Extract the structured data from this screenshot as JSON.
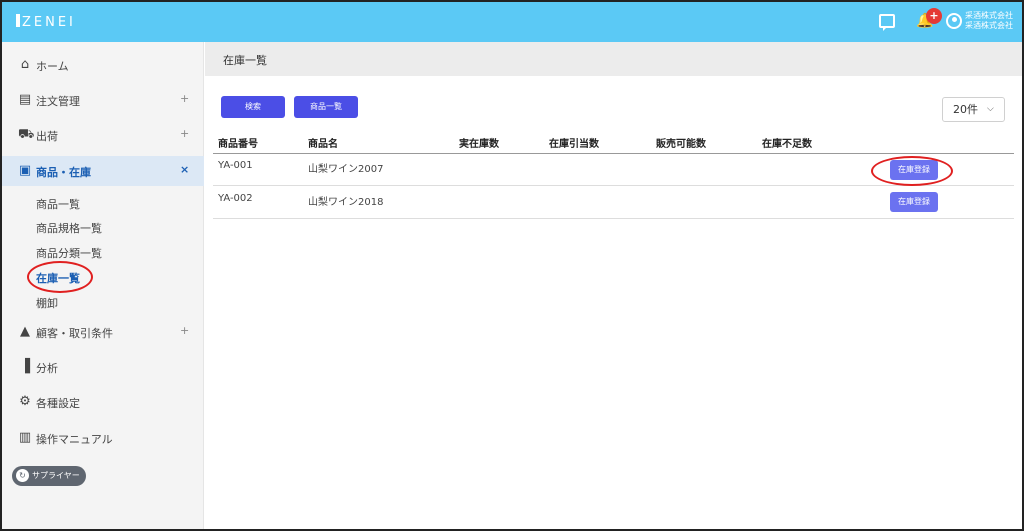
{
  "header": {
    "logo": "ZENEI",
    "notification_count": "+",
    "company_line1": "采酒株式会社",
    "company_line2": "采酒株式会社"
  },
  "sidebar": {
    "items": [
      {
        "label": "ホーム",
        "icon": "home-icon",
        "toggle": ""
      },
      {
        "label": "注文管理",
        "icon": "orders-icon",
        "toggle": "+"
      },
      {
        "label": "出荷",
        "icon": "truck-icon",
        "toggle": "+"
      },
      {
        "label": "商品・在庫",
        "icon": "inventory-icon",
        "toggle": "×"
      },
      {
        "label": "顧客・取引条件",
        "icon": "person-icon",
        "toggle": "+"
      },
      {
        "label": "分析",
        "icon": "bar-chart-icon",
        "toggle": ""
      },
      {
        "label": "各種設定",
        "icon": "gear-icon",
        "toggle": ""
      },
      {
        "label": "操作マニュアル",
        "icon": "book-icon",
        "toggle": ""
      }
    ],
    "sub_items": [
      "商品一覧",
      "商品規格一覧",
      "商品分類一覧",
      "在庫一覧",
      "棚卸"
    ],
    "supplier_label": "サプライヤー"
  },
  "page": {
    "title": "在庫一覧",
    "search_button": "検索",
    "product_list_button": "商品一覧",
    "per_page": "20件"
  },
  "table": {
    "headers": [
      "商品番号",
      "商品名",
      "実在庫数",
      "在庫引当数",
      "販売可能数",
      "在庫不足数"
    ],
    "rows": [
      {
        "code": "YA-001",
        "name": "山梨ワイン2007",
        "action": "在庫登録"
      },
      {
        "code": "YA-002",
        "name": "山梨ワイン2018",
        "action": "在庫登録"
      }
    ]
  },
  "colors": {
    "header_bg": "#5bc9f5",
    "primary_button": "#4b4ee6",
    "active_nav": "#1b5fb3",
    "annotation": "#e02020"
  }
}
